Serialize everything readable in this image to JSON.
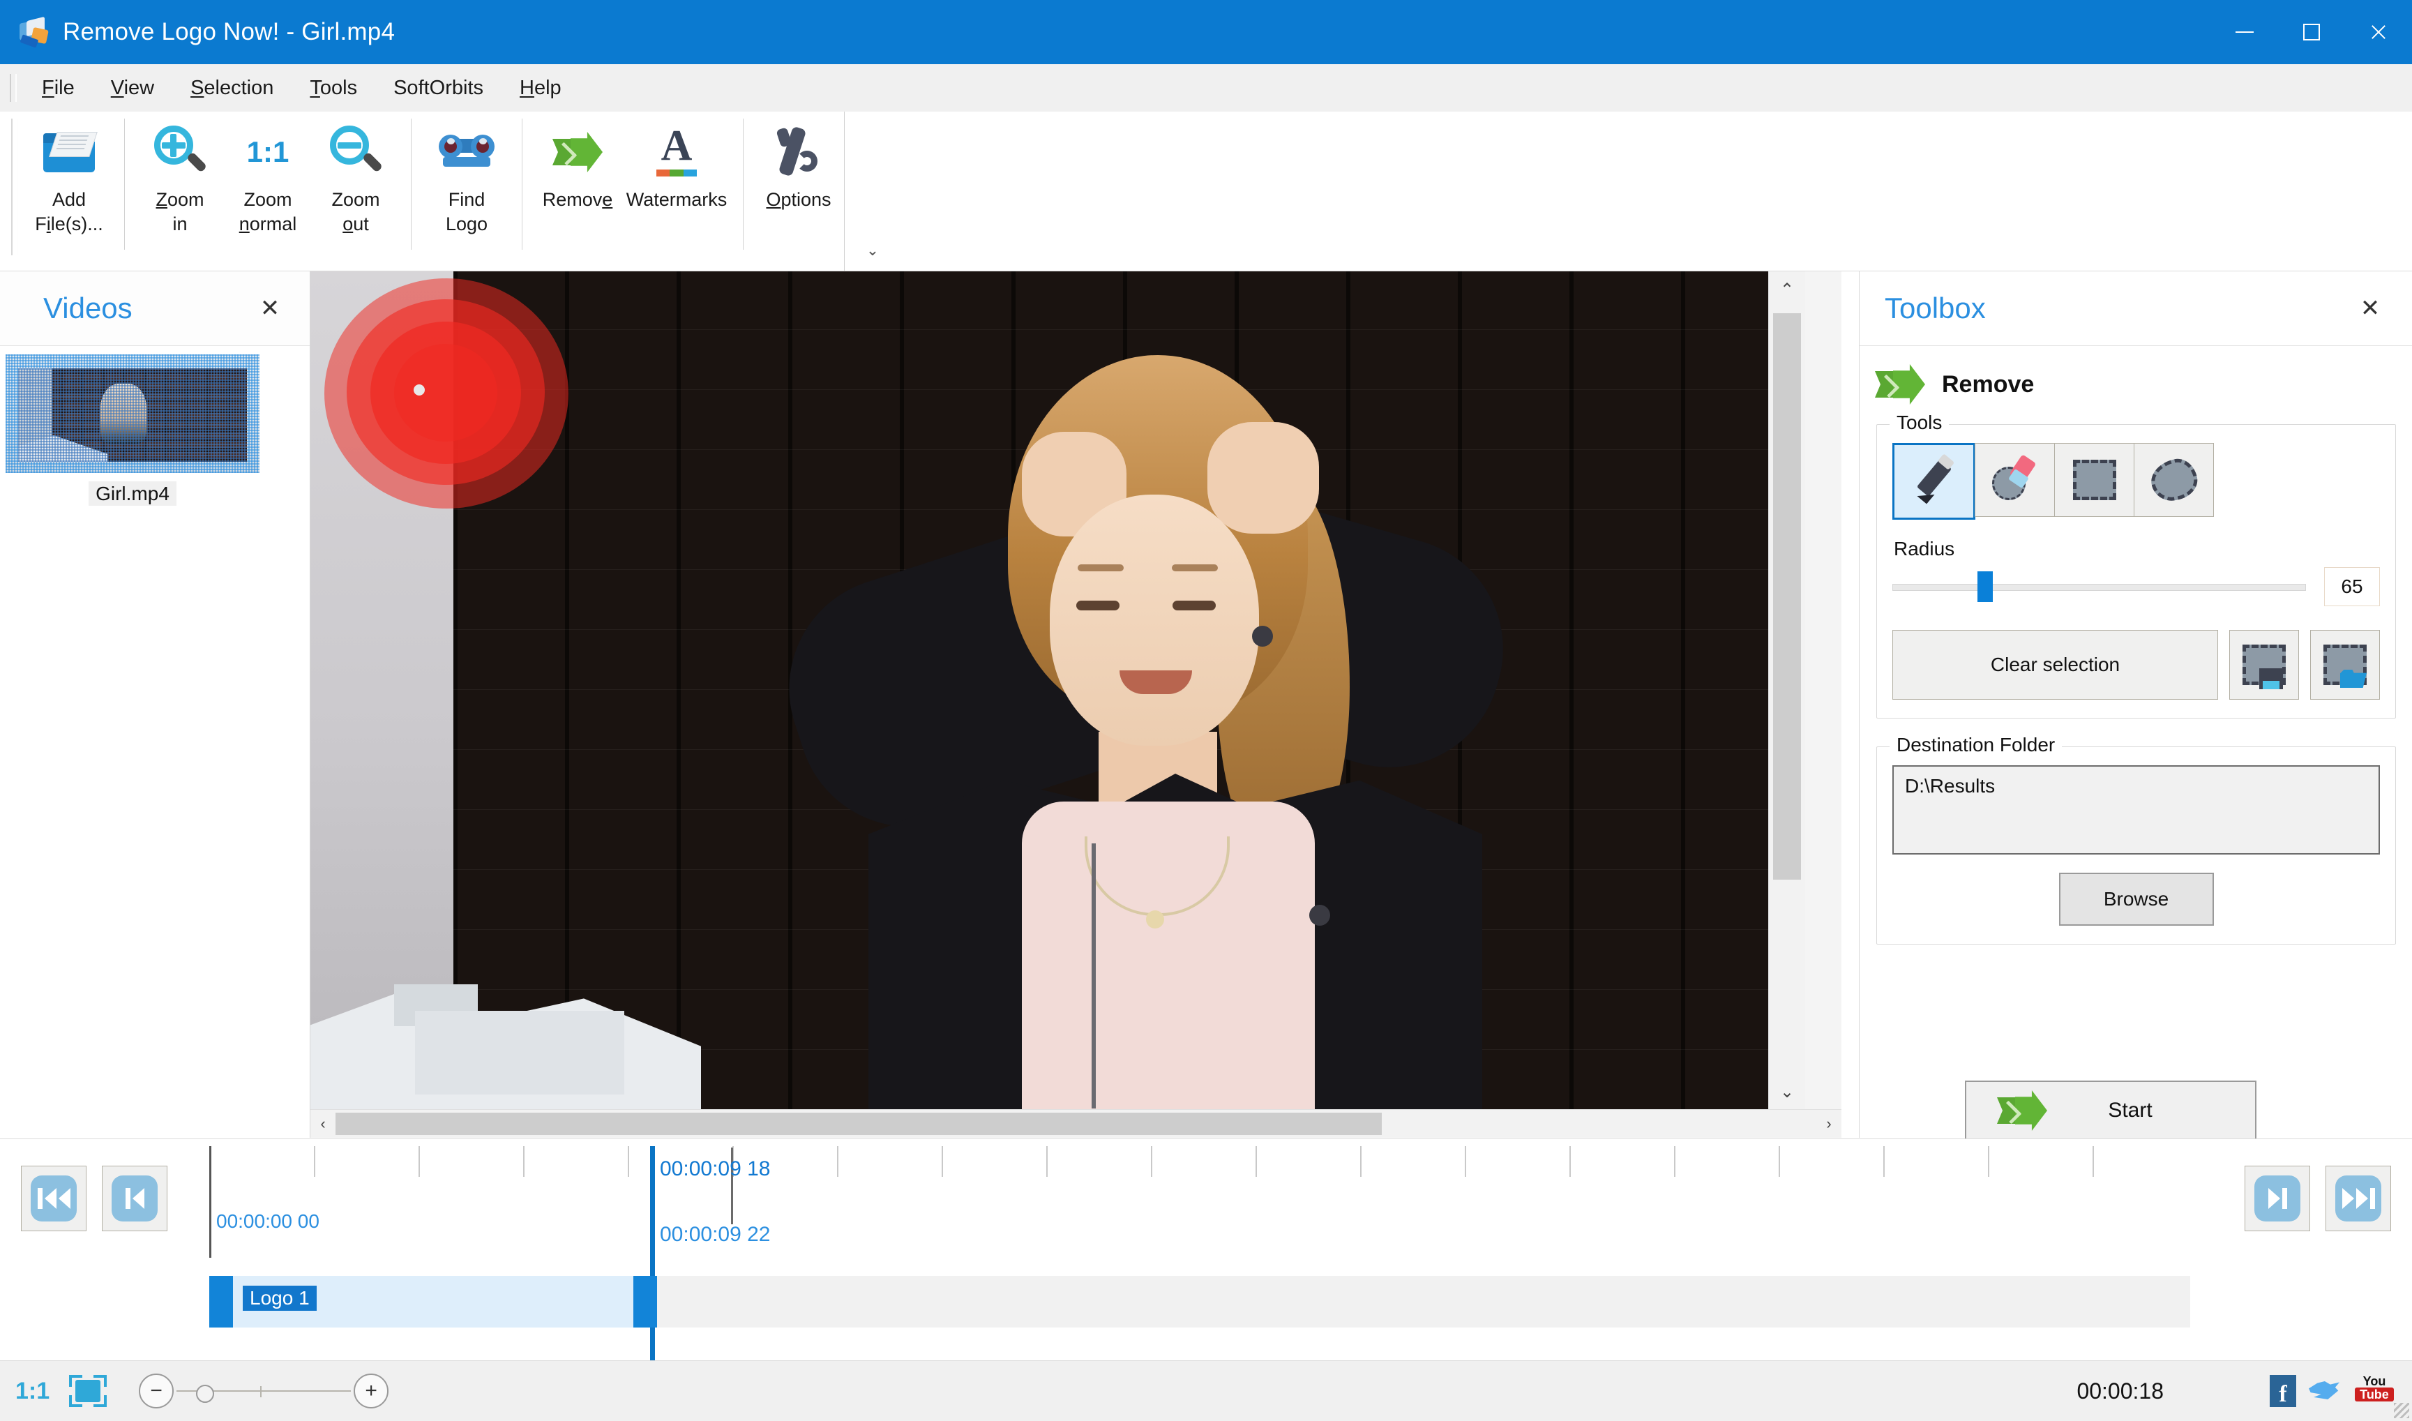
{
  "window": {
    "title": "Remove Logo Now! - Girl.mp4",
    "app_icon": "app-logo-icon",
    "minimize": "–",
    "maximize": "□",
    "close": "✕",
    "titlebar_color": "#0b7ad0"
  },
  "menubar": {
    "items": [
      {
        "label": "File",
        "accel": "F"
      },
      {
        "label": "View",
        "accel": "V"
      },
      {
        "label": "Selection",
        "accel": "S"
      },
      {
        "label": "Tools",
        "accel": "T"
      },
      {
        "label": "SoftOrbits",
        "accel": ""
      },
      {
        "label": "Help",
        "accel": "H"
      }
    ]
  },
  "ribbon": {
    "buttons": [
      {
        "label_line1": "Add",
        "label_line2": "File(s)...",
        "icon": "open-folder-icon"
      },
      {
        "label_line1": "Zoom",
        "label_line2": "in",
        "icon": "zoom-in-icon"
      },
      {
        "label_line1": "Zoom",
        "label_line2": "normal",
        "icon": "zoom-normal-icon",
        "icon_text": "1:1"
      },
      {
        "label_line1": "Zoom",
        "label_line2": "out",
        "icon": "zoom-out-icon"
      },
      {
        "label_line1": "Find",
        "label_line2": "Logo",
        "icon": "binoculars-icon"
      },
      {
        "label_line1": "Remove",
        "label_line2": "",
        "icon": "green-arrow-icon"
      },
      {
        "label_line1": "Watermarks",
        "label_line2": "",
        "icon": "watermark-a-icon"
      },
      {
        "label_line1": "Options",
        "label_line2": "",
        "icon": "wrench-icon"
      }
    ],
    "expand_glyph": "⌄"
  },
  "videos_panel": {
    "title": "Videos",
    "close_glyph": "✕",
    "items": [
      {
        "name": "Girl.mp4",
        "selected": true
      }
    ]
  },
  "canvas": {
    "scroll_up_glyph": "⌃",
    "scroll_down_glyph": "⌄",
    "scroll_left_glyph": "‹",
    "scroll_right_glyph": "›",
    "selection_overlay_color": "#f02a22"
  },
  "toolbox": {
    "title": "Toolbox",
    "close_glyph": "✕",
    "mode_label": "Remove",
    "mode_icon": "green-arrow-icon",
    "tools_group_label": "Tools",
    "tools": [
      {
        "name": "pencil-tool",
        "selected": true
      },
      {
        "name": "eraser-tool",
        "selected": false
      },
      {
        "name": "rectangle-select-tool",
        "selected": false
      },
      {
        "name": "lasso-select-tool",
        "selected": false
      }
    ],
    "radius_label": "Radius",
    "radius_value": "65",
    "radius_percent": 21,
    "clear_selection_label": "Clear selection",
    "save_selection_icon": "save-selection-icon",
    "load_selection_icon": "load-selection-icon",
    "destination_group_label": "Destination Folder",
    "destination_path": "D:\\Results",
    "browse_label": "Browse",
    "start_label": "Start",
    "accent_color": "#2b8fe0"
  },
  "timeline": {
    "transport_left": [
      {
        "name": "skip-to-start-button",
        "glyph": "⏮"
      },
      {
        "name": "previous-frame-button",
        "glyph": "◀|"
      }
    ],
    "transport_right": [
      {
        "name": "next-frame-button",
        "glyph": "|▶"
      },
      {
        "name": "skip-to-end-button",
        "glyph": "⏭"
      }
    ],
    "start_time": "00:00:00 00",
    "playhead_time_top": "00:00:09 18",
    "playhead_time_bottom": "00:00:09 22",
    "playhead_percent": 22.2,
    "clip": {
      "name": "Logo 1",
      "start_percent": 0,
      "width_percent": 22.6
    }
  },
  "statusbar": {
    "zoom_ratio": "1:1",
    "fit_icon": "fit-to-window-icon",
    "zoom_out_glyph": "−",
    "zoom_in_glyph": "+",
    "duration": "00:00:18",
    "socials": [
      {
        "name": "facebook-icon",
        "label": "f"
      },
      {
        "name": "twitter-icon",
        "label": ""
      },
      {
        "name": "youtube-icon",
        "label_top": "You",
        "label_bottom": "Tube"
      }
    ]
  }
}
